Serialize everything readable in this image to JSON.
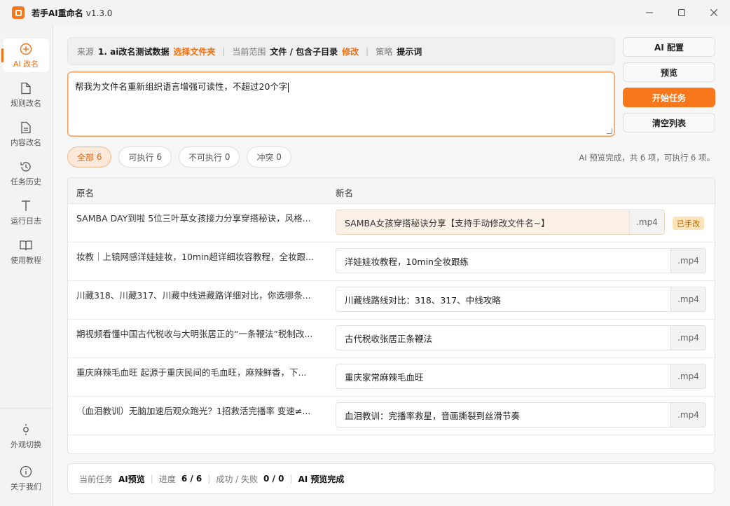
{
  "window": {
    "title": "若手AI重命名",
    "version": "v1.3.0",
    "minimize_icon": "minimize-icon",
    "maximize_icon": "maximize-icon",
    "close_icon": "close-icon"
  },
  "sidebar": {
    "items": [
      {
        "label": "AI 改名",
        "icon": "plus-circle-icon",
        "active": true
      },
      {
        "label": "规则改名",
        "icon": "file-icon"
      },
      {
        "label": "内容改名",
        "icon": "file-text-icon"
      },
      {
        "label": "任务历史",
        "icon": "history-icon"
      },
      {
        "label": "运行日志",
        "icon": "text-icon"
      },
      {
        "label": "使用教程",
        "icon": "book-icon"
      }
    ],
    "bottom_items": [
      {
        "label": "外观切换",
        "icon": "sun-icon"
      },
      {
        "label": "关于我们",
        "icon": "info-icon"
      }
    ]
  },
  "source_bar": {
    "source_key": "来源",
    "source_value": "1. ai改名测试数据",
    "source_action": "选择文件夹",
    "scope_key": "当前范围",
    "scope_value": "文件 / 包含子目录",
    "scope_action": "修改",
    "strategy_key": "策略",
    "strategy_value": "提示词",
    "separator": "|"
  },
  "prompt": {
    "value": "帮我为文件名重新组织语言增强可读性，不超过20个字"
  },
  "actions": {
    "ai_config": "AI 配置",
    "preview": "预览",
    "start": "开始任务",
    "clear": "清空列表"
  },
  "filters": [
    {
      "label": "全部",
      "count": "6",
      "active": true
    },
    {
      "label": "可执行",
      "count": "6"
    },
    {
      "label": "不可执行",
      "count": "0"
    },
    {
      "label": "冲突",
      "count": "0"
    }
  ],
  "status_summary": "AI 预览完成，共 6 项，可执行 6 项。",
  "table": {
    "col_original": "原名",
    "col_new": "新名",
    "edited_badge": "已手改",
    "rows": [
      {
        "original": "SAMBA DAY到啦 5位三叶草女孩接力分享穿搭秘诀，风格...",
        "new": "SAMBA女孩穿搭秘诀分享【支持手动修改文件名~】",
        "ext": ".mp4",
        "edited": true
      },
      {
        "original": "妆教｜上镜网感洋娃娃妆，10min超详细妆容教程，全妆跟...",
        "new": "洋娃娃妆教程，10min全妆跟练",
        "ext": ".mp4"
      },
      {
        "original": "川藏318、川藏317、川藏中线进藏路详细对比，你选哪条...",
        "new": "川藏线路线对比：318、317、中线攻略",
        "ext": ".mp4"
      },
      {
        "original": "期视频看懂中国古代税收与大明张居正的“一条鞭法”税制改...",
        "new": "古代税收张居正条鞭法",
        "ext": ".mp4"
      },
      {
        "original": "重庆麻辣毛血旺 起源于重庆民间的毛血旺，麻辣鲜香，下...",
        "new": "重庆家常麻辣毛血旺",
        "ext": ".mp4"
      },
      {
        "original": "（血泪教训）无脑加速后观众跑光？1招救活完播率 变速≠...",
        "new": "血泪教训：完播率救星，音画撕裂到丝滑节奏",
        "ext": ".mp4"
      }
    ]
  },
  "footer": {
    "task_key": "当前任务",
    "task_value": "AI预览",
    "progress_key": "进度",
    "progress_value": "6 / 6",
    "result_key": "成功 / 失败",
    "result_value": "0 / 0",
    "status_value": "AI 预览完成",
    "separator": "|"
  },
  "colors": {
    "accent": "#f7771a",
    "accent_light": "#fde9d9",
    "badge_bg": "#fde4b8"
  }
}
